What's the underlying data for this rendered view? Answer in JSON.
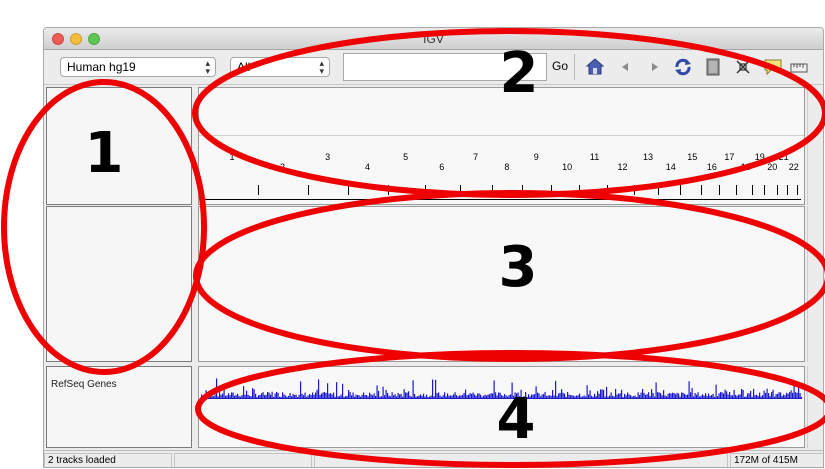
{
  "window": {
    "title": "IGV"
  },
  "toolbar": {
    "genome": "Human hg19",
    "chromosome": "All",
    "locus_value": "",
    "go_label": "Go",
    "icons": [
      "home-icon",
      "back-icon",
      "forward-icon",
      "refresh-icon",
      "roi-icon",
      "resize-icon",
      "popup-info-icon",
      "ruler-icon"
    ]
  },
  "ruler": {
    "chromosomes": [
      "1",
      "2",
      "3",
      "4",
      "5",
      "6",
      "7",
      "8",
      "9",
      "10",
      "11",
      "12",
      "13",
      "14",
      "15",
      "16",
      "17",
      "18",
      "19",
      "20",
      "21",
      "22"
    ]
  },
  "tracks": [
    {
      "name": "RefSeq Genes"
    }
  ],
  "status": {
    "message": "2 tracks loaded",
    "memory": "172M of 415M"
  },
  "annotations": {
    "labels": [
      "1",
      "2",
      "3",
      "4"
    ],
    "color": "#ee0000"
  },
  "colors": {
    "gene_density": "#1a1acc",
    "annotation": "#ee0000"
  }
}
